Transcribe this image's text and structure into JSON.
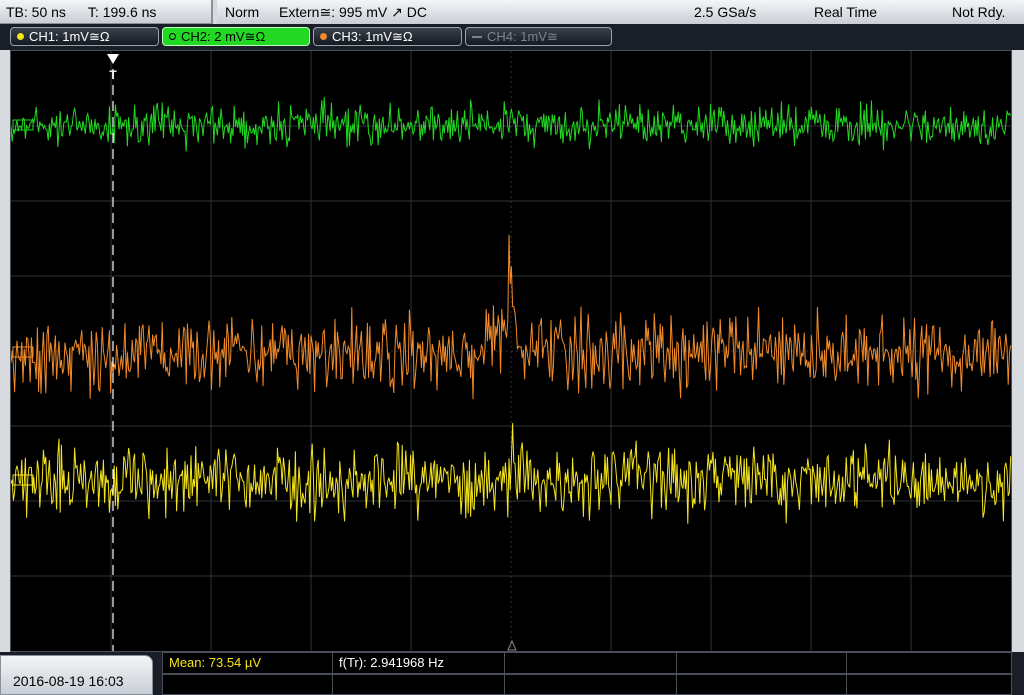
{
  "header": {
    "timebase": "TB: 50 ns",
    "trigger_time": "T: 199.6 ns",
    "mode": "Norm",
    "trigger_source": "Extern≅: 995 mV ↗ DC",
    "sample_rate": "2.5 GSa/s",
    "acq_mode": "Real Time",
    "status": "Not Rdy."
  },
  "channels": [
    {
      "label": "CH1: 1mV≅Ω",
      "color": "#f5e51c",
      "state": "on"
    },
    {
      "label": "CH2: 2 mV≅Ω",
      "color": "#22d822",
      "state": "selected"
    },
    {
      "label": "CH3: 1mV≅Ω",
      "color": "#f08a2a",
      "state": "on"
    },
    {
      "label": "CH4: 1mV≅",
      "color": "#7f858e",
      "state": "off"
    }
  ],
  "waveforms": {
    "ch1_color": "#f5e51c",
    "ch2_color": "#22d822",
    "ch3_color": "#f08a2a",
    "trigger_marker": "T"
  },
  "measurements": {
    "mean": "Mean: 73.54 µV",
    "freq": "f(Tr): 2.941968 Hz"
  },
  "footer": {
    "datetime": "2016-08-19 16:03"
  }
}
